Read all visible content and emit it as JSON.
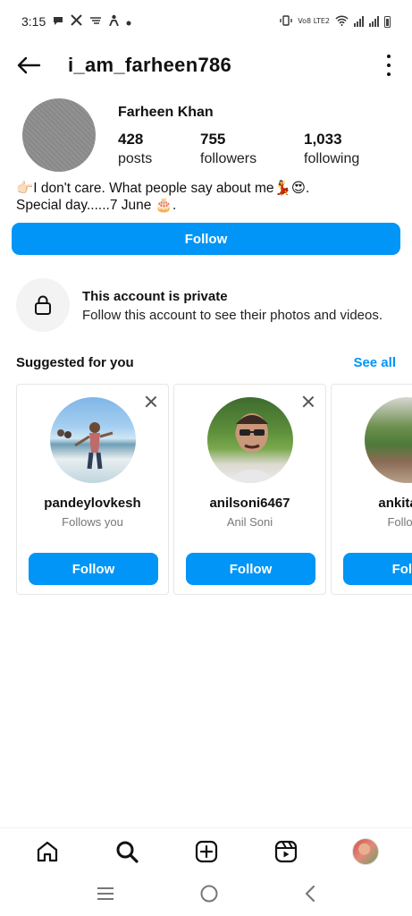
{
  "status_bar": {
    "time": "3:15",
    "right_label_top": "Vo8 LTE2"
  },
  "header": {
    "username": "i_am_farheen786"
  },
  "profile": {
    "full_name": "Farheen Khan",
    "stats": [
      {
        "value": "428",
        "label": "posts"
      },
      {
        "value": "755",
        "label": "followers"
      },
      {
        "value": "1,033",
        "label": "following"
      }
    ],
    "bio_line1": "👉🏻I don't care. What people say about me💃😍.",
    "bio_line2": "Special day......7 June 🎂.",
    "follow_label": "Follow"
  },
  "private_notice": {
    "title": "This account is private",
    "subtitle": "Follow this account to see their photos and videos."
  },
  "suggested": {
    "title": "Suggested for you",
    "see_all": "See all",
    "cards": [
      {
        "username": "pandeylovkesh",
        "subtitle": "Follows you",
        "button": "Follow"
      },
      {
        "username": "anilsoni6467",
        "subtitle": "Anil Soni",
        "button": "Follow"
      },
      {
        "username": "ankitatiw",
        "subtitle": "Follows",
        "button": "Follo"
      }
    ]
  },
  "colors": {
    "accent": "#0095f6",
    "text": "#111111",
    "muted": "#777777"
  },
  "icons": {
    "back": "arrow-left-icon",
    "more": "more-vertical-icon",
    "lock": "lock-icon",
    "home": "home-icon",
    "search": "search-icon",
    "create": "plus-square-icon",
    "reels": "reels-icon"
  }
}
